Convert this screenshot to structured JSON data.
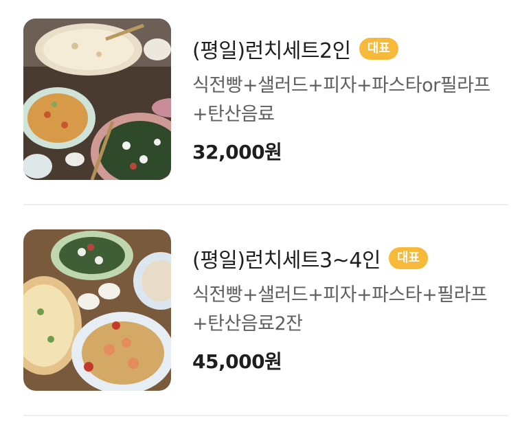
{
  "menu": {
    "items": [
      {
        "title": "(평일)런치세트2인",
        "badge": "대표",
        "description": "식전빵+샐러드+피자+파스타or필라프+탄산음료",
        "price": "32,000원",
        "image_icon": "lunch-set-photo"
      },
      {
        "title": "(평일)런치세트3~4인",
        "badge": "대표",
        "description": "식전빵+샐러드+피자+파스타+필라프+탄산음료2잔",
        "price": "45,000원",
        "image_icon": "lunch-set-photo"
      }
    ]
  },
  "colors": {
    "badge_background": "#f7b93a",
    "badge_text": "#ffffff",
    "title": "#1e1e1e",
    "description": "#5f5f5f",
    "divider": "#eeeeee"
  }
}
